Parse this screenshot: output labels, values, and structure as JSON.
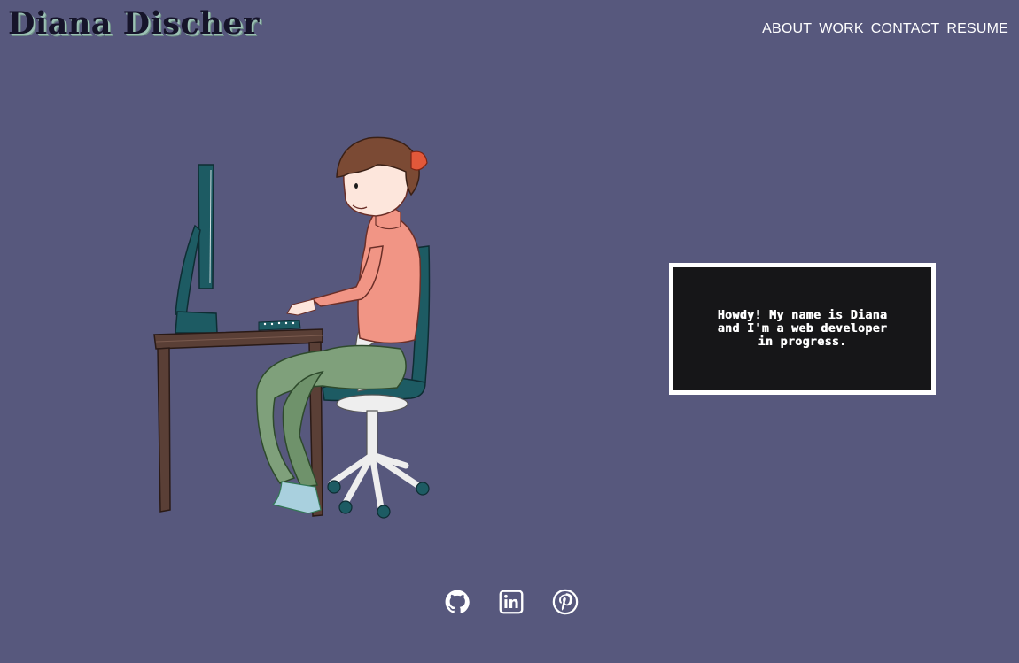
{
  "header": {
    "logo_text": "Diana Discher"
  },
  "nav": {
    "items": [
      {
        "label": "ABOUT"
      },
      {
        "label": "WORK"
      },
      {
        "label": "CONTACT"
      },
      {
        "label": "RESUME"
      }
    ]
  },
  "hero": {
    "intro_text": "Howdy! My name is Diana and I'm a web developer in progress."
  },
  "socials": [
    {
      "icon": "github-icon"
    },
    {
      "icon": "linkedin-icon"
    },
    {
      "icon": "pinterest-icon"
    }
  ],
  "colors": {
    "background": "#57587d",
    "logo_text": "#16142a",
    "nav_text": "#ffffff",
    "terminal_bg": "#161618",
    "terminal_border": "#ffffff"
  }
}
